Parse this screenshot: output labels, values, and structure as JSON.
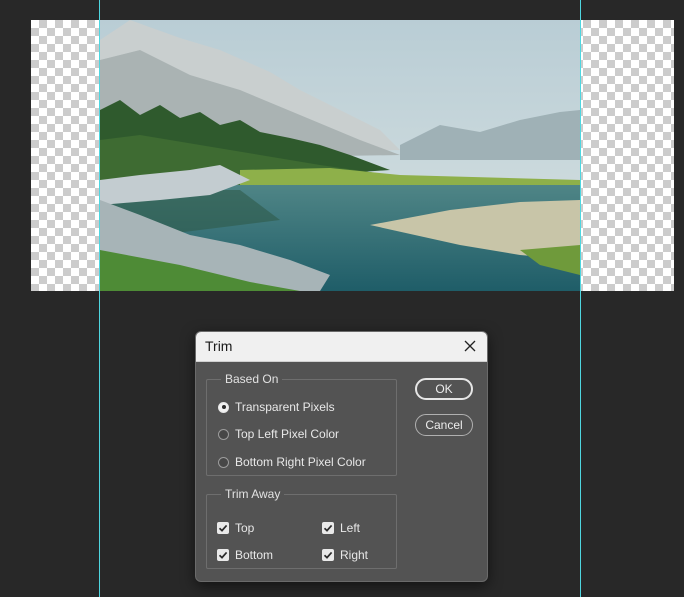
{
  "dialog": {
    "title": "Trim",
    "based_on": {
      "label": "Based On",
      "options": [
        {
          "label": "Transparent Pixels",
          "selected": true
        },
        {
          "label": "Top Left Pixel Color",
          "selected": false
        },
        {
          "label": "Bottom Right Pixel Color",
          "selected": false
        }
      ]
    },
    "trim_away": {
      "label": "Trim Away",
      "options": [
        {
          "label": "Top",
          "checked": true
        },
        {
          "label": "Left",
          "checked": true
        },
        {
          "label": "Bottom",
          "checked": true
        },
        {
          "label": "Right",
          "checked": true
        }
      ]
    },
    "buttons": {
      "ok": "OK",
      "cancel": "Cancel"
    }
  },
  "colors": {
    "workspace": "#282828",
    "guide": "#4fd6e0",
    "dialog_body": "#535353",
    "titlebar": "#f0f0f0"
  },
  "icons": {
    "close": "close-icon",
    "check": "checkmark-icon"
  }
}
